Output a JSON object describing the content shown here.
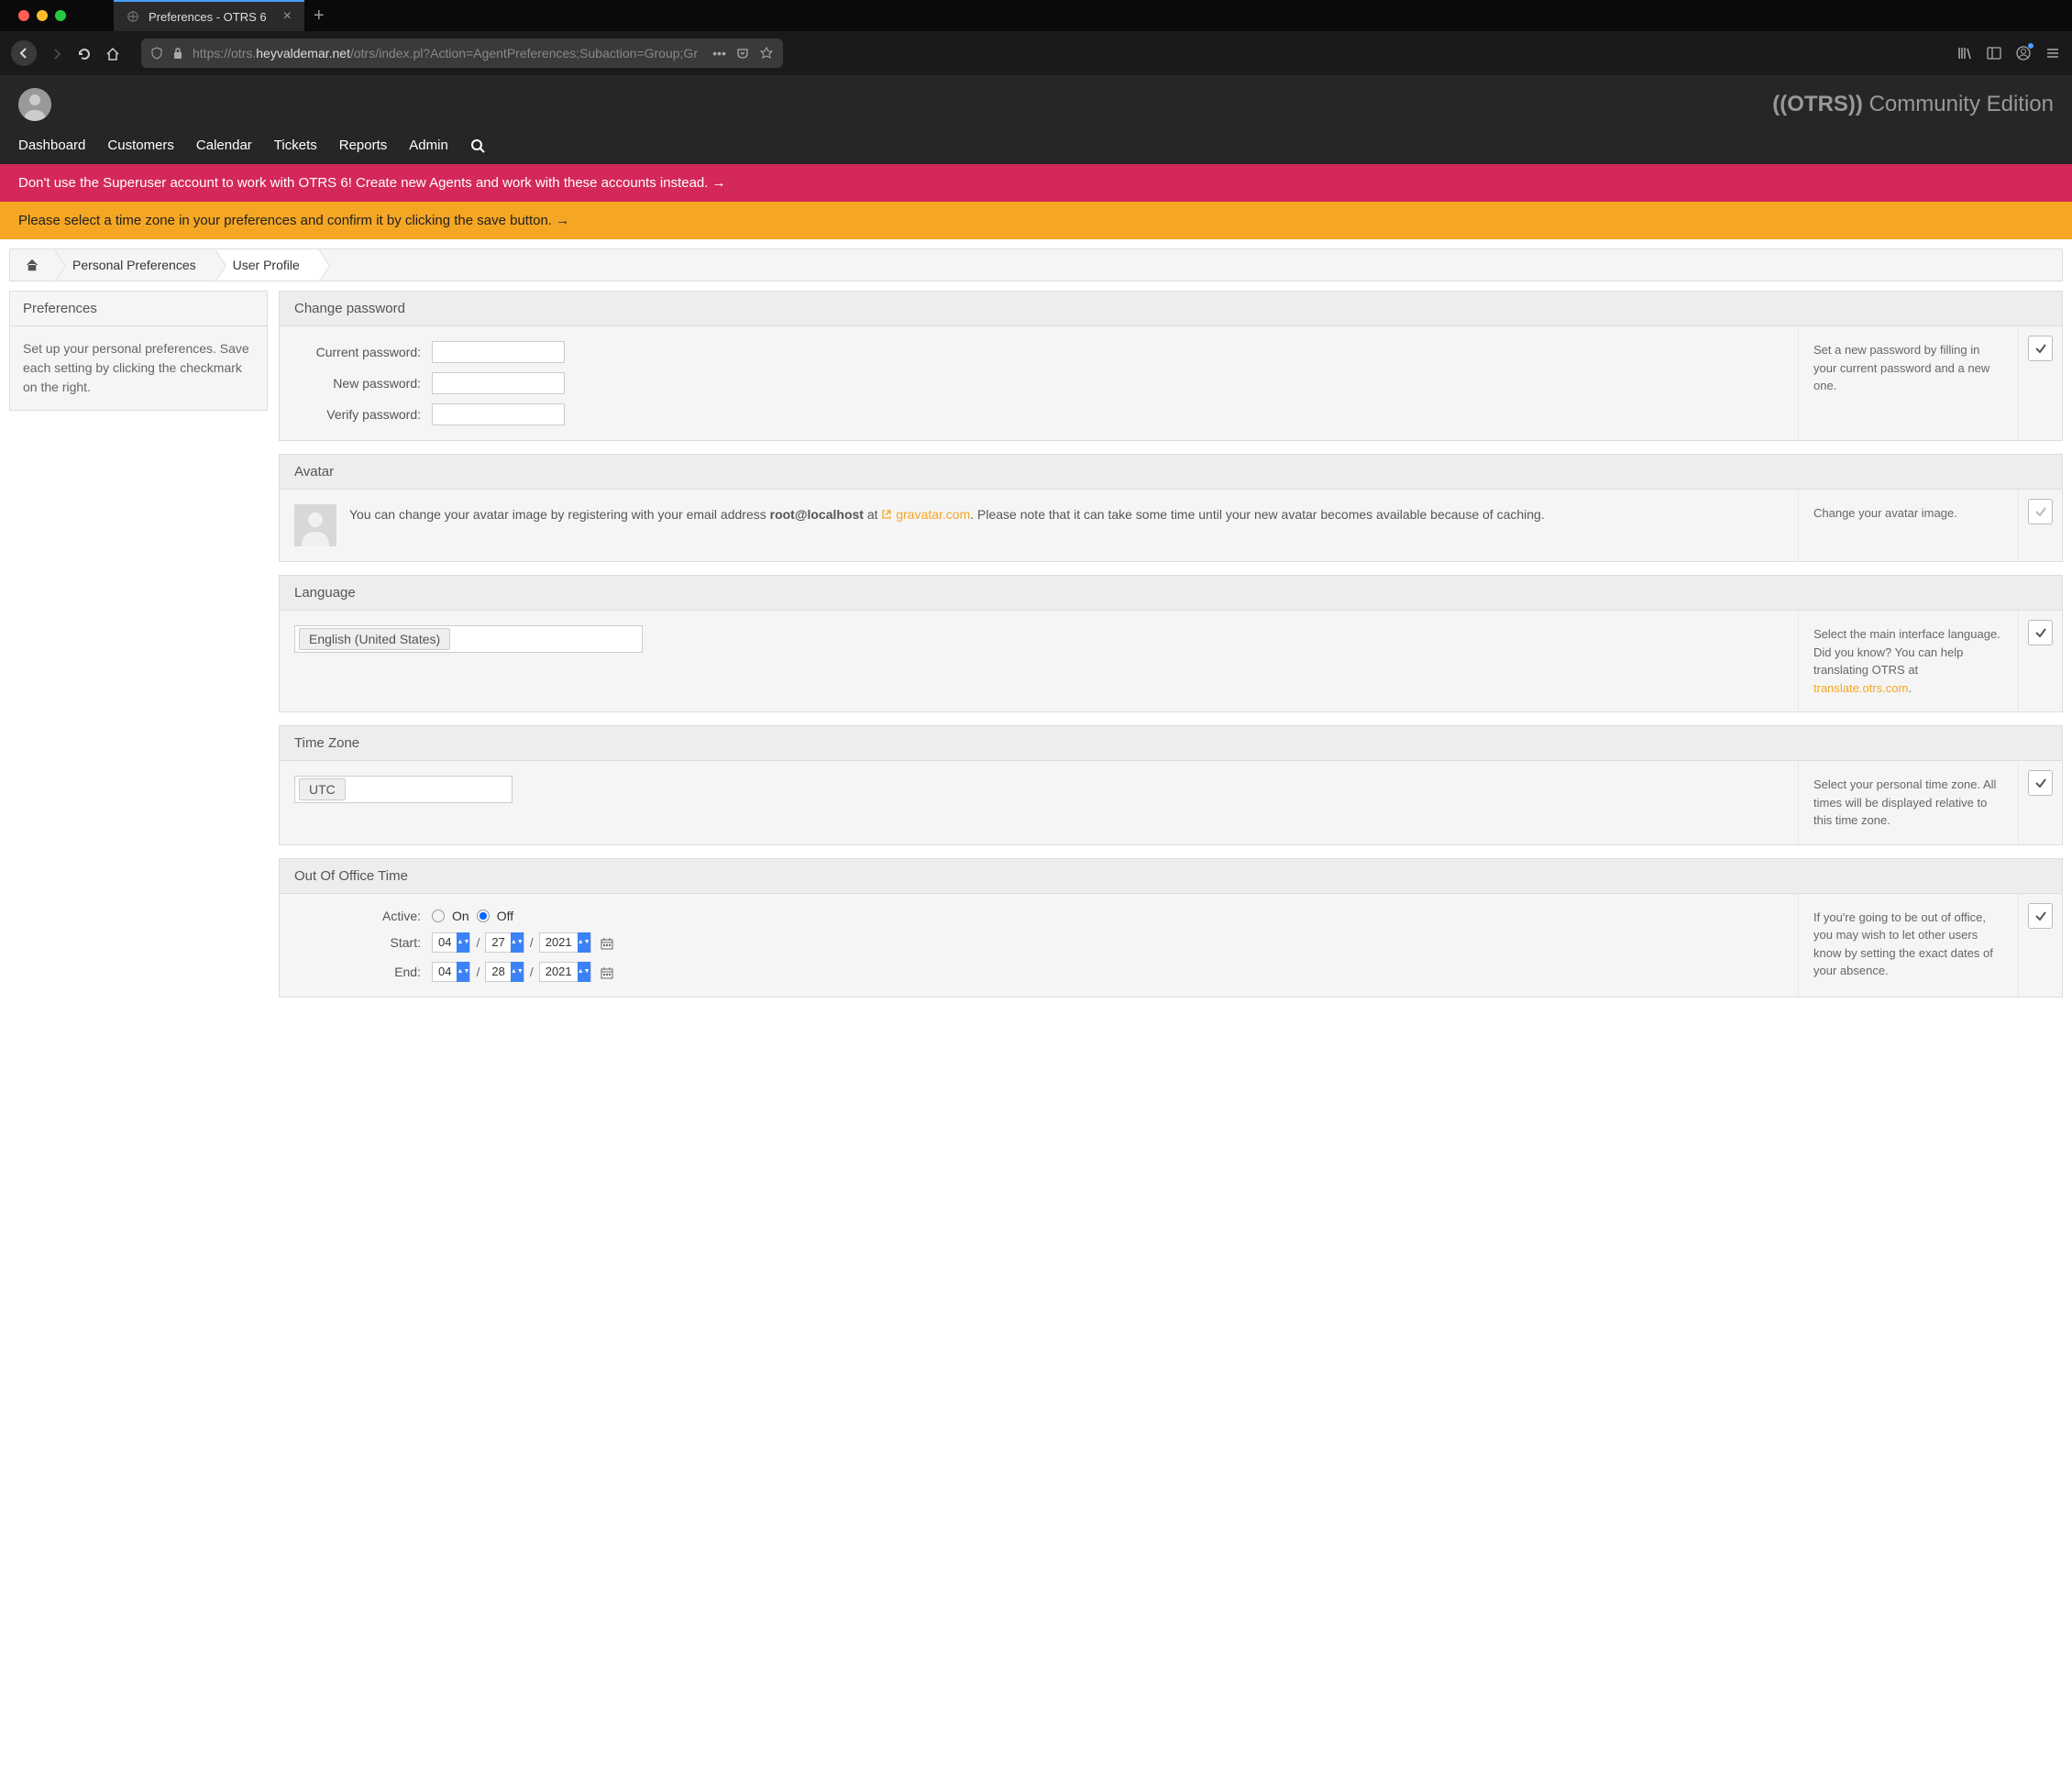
{
  "browser": {
    "tab_title": "Preferences - OTRS 6",
    "url_prefix": "https://otrs.",
    "url_domain": "heyvaldemar.net",
    "url_suffix": "/otrs/index.pl?Action=AgentPreferences;Subaction=Group;Gr"
  },
  "header": {
    "brand_bold": "((OTRS))",
    "brand_rest": " Community Edition"
  },
  "nav": {
    "dashboard": "Dashboard",
    "customers": "Customers",
    "calendar": "Calendar",
    "tickets": "Tickets",
    "reports": "Reports",
    "admin": "Admin"
  },
  "alerts": {
    "red": "Don't use the Superuser account to work with OTRS 6! Create new Agents and work with these accounts instead. →",
    "yellow": "Please select a time zone in your preferences and confirm it by clicking the save button. →"
  },
  "breadcrumb": {
    "personal": "Personal Preferences",
    "user_profile": "User Profile"
  },
  "sidebar": {
    "title": "Preferences",
    "desc": "Set up your personal preferences. Save each setting by clicking the checkmark on the right."
  },
  "sections": {
    "password": {
      "title": "Change password",
      "current": "Current password:",
      "new": "New password:",
      "verify": "Verify password:",
      "help": "Set a new password by filling in your current password and a new one."
    },
    "avatar": {
      "title": "Avatar",
      "text1": "You can change your avatar image by registering with your email address ",
      "email": "root@localhost",
      "text2": " at ",
      "link": "gravatar.com",
      "text3": ". Please note that it can take some time until your new avatar becomes available because of caching.",
      "help": "Change your avatar image."
    },
    "language": {
      "title": "Language",
      "value": "English (United States)",
      "help1": "Select the main interface language. Did you know? You can help translating OTRS at ",
      "help_link": "translate.otrs.com",
      "help2": "."
    },
    "timezone": {
      "title": "Time Zone",
      "value": "UTC",
      "help": "Select your personal time zone. All times will be displayed relative to this time zone."
    },
    "ooo": {
      "title": "Out Of Office Time",
      "active_label": "Active:",
      "on": "On",
      "off": "Off",
      "start_label": "Start:",
      "end_label": "End:",
      "start": {
        "m": "04",
        "d": "27",
        "y": "2021"
      },
      "end": {
        "m": "04",
        "d": "28",
        "y": "2021"
      },
      "help": "If you're going to be out of office, you may wish to let other users know by setting the exact dates of your absence."
    }
  }
}
